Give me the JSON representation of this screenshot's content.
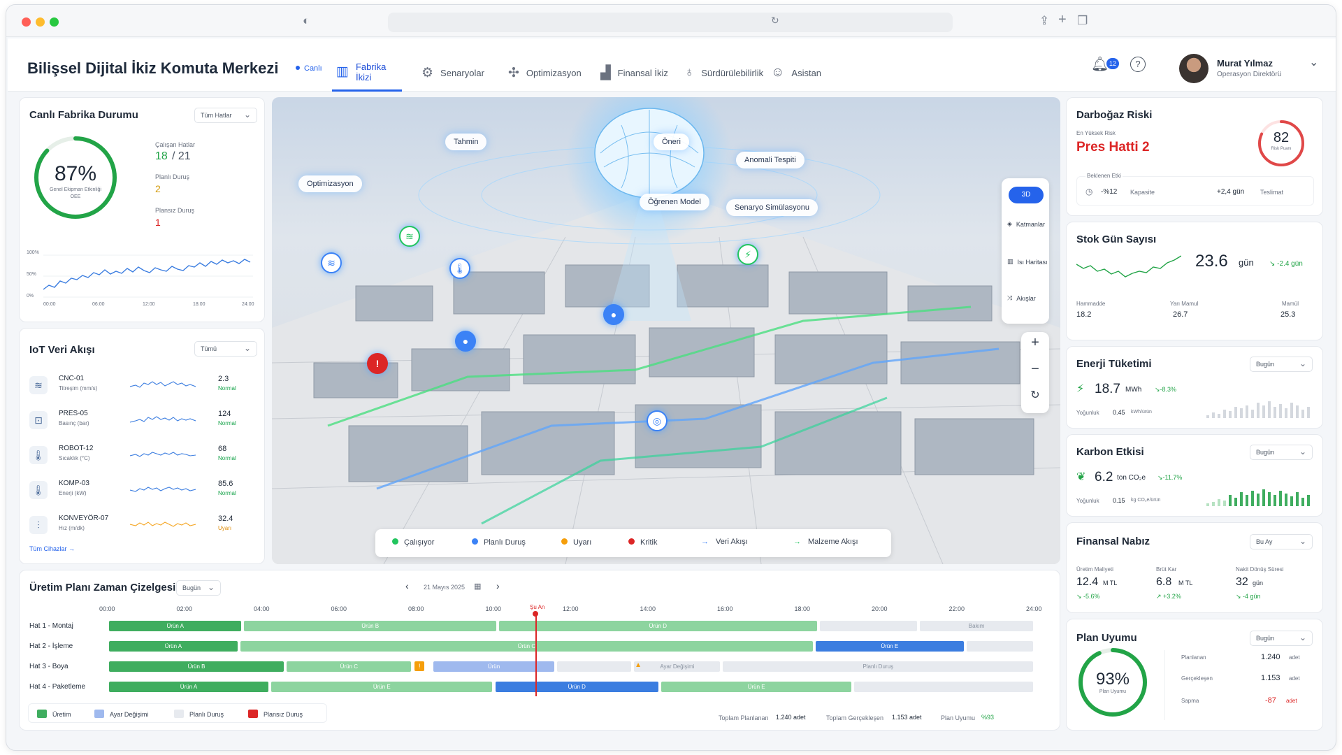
{
  "app": {
    "title": "Bilişsel Dijital İkiz Komuta Merkezi",
    "live_label": "Canlı",
    "nav": [
      {
        "label": "Fabrika İkizi",
        "icon": "factory-icon",
        "active": true
      },
      {
        "label": "Senaryolar",
        "icon": "scenario-icon",
        "active": false
      },
      {
        "label": "Optimizasyon",
        "icon": "optimization-icon",
        "active": false
      },
      {
        "label": "Finansal İkiz",
        "icon": "finance-icon",
        "active": false
      },
      {
        "label": "Sürdürülebilirlik",
        "icon": "sustainability-icon",
        "active": false
      },
      {
        "label": "Asistan",
        "icon": "assistant-icon",
        "active": false
      }
    ],
    "notifications": "12",
    "user": {
      "name": "Murat Yılmaz",
      "role": "Operasyon Direktörü"
    }
  },
  "factory": {
    "title": "Canlı Fabrika Durumu",
    "filter": "Tüm Hatlar",
    "oee_value": "87%",
    "oee_fraction": 0.87,
    "oee_label_1": "Genel Ekipman Etkinliği",
    "oee_label_2": "OEE",
    "running_label": "Çalışan Hatlar",
    "running_value": "18",
    "running_total": "/ 21",
    "planned_label": "Planlı Duruş",
    "planned_value": "2",
    "unplanned_label": "Plansız Duruş",
    "unplanned_value": "1",
    "chart_ylabels": [
      "100%",
      "50%",
      "0%"
    ],
    "chart_xlabels": [
      "00:00",
      "06:00",
      "12:00",
      "18:00",
      "24:00"
    ]
  },
  "iot": {
    "title": "IoT Veri Akışı",
    "filter": "Tümü",
    "rows": [
      {
        "name": "CNC-01",
        "sub": "Titreşim (mm/s)",
        "value": "2.3",
        "status": "Normal",
        "icon": "wifi-icon"
      },
      {
        "name": "PRES-05",
        "sub": "Basınç (bar)",
        "value": "124",
        "status": "Normal",
        "icon": "press-icon"
      },
      {
        "name": "ROBOT-12",
        "sub": "Sıcaklık (°C)",
        "value": "68",
        "status": "Normal",
        "icon": "thermometer-icon"
      },
      {
        "name": "KOMP-03",
        "sub": "Enerji (kW)",
        "value": "85.6",
        "status": "Normal",
        "icon": "energy-icon"
      },
      {
        "name": "KONVEYÖR-07",
        "sub": "Hız (m/dk)",
        "value": "32.4",
        "status": "Uyarı",
        "icon": "conveyor-icon"
      }
    ],
    "all_devices": "Tüm Cihazlar"
  },
  "twin": {
    "tags": [
      "Tahmin",
      "Öneri",
      "Anomali Tespiti",
      "Optimizasyon",
      "Öğrenen Model",
      "Senaryo Simülasyonu"
    ],
    "view_3d": "3D",
    "layers": "Katmanlar",
    "heatmap": "Isı Haritası",
    "flows": "Akışlar",
    "legend": [
      "Çalışıyor",
      "Planlı Duruş",
      "Uyarı",
      "Kritik",
      "Veri Akışı",
      "Malzeme Akışı"
    ]
  },
  "bottleneck": {
    "title": "Darboğaz Riski",
    "top_risk_label": "En Yüksek Risk",
    "top_risk": "Pres Hatti 2",
    "score": "82",
    "score_fraction": 0.82,
    "score_label": "Risk Puanı",
    "impact_label": "Beklenen Etki",
    "capacity_value": "-%12",
    "capacity_label": "Kapasite",
    "delivery_value": "+2,4 gün",
    "delivery_label": "Teslimat"
  },
  "stock": {
    "title": "Stok Gün Sayısı",
    "value": "23.6",
    "unit": "gün",
    "delta": "-2.4 gün",
    "items": [
      {
        "label": "Hammadde",
        "value": "18.2"
      },
      {
        "label": "Yarı Mamul",
        "value": "26.7"
      },
      {
        "label": "Mamül",
        "value": "25.3"
      }
    ]
  },
  "energy": {
    "title": "Enerji Tüketimi",
    "filter": "Bugün",
    "value": "18.7",
    "unit": "MWh",
    "delta": "-8.3%",
    "intensity_label": "Yoğunluk",
    "intensity_value": "0.45",
    "intensity_unit": "kWh/ürün"
  },
  "carbon": {
    "title": "Karbon Etkisi",
    "filter": "Bugün",
    "value": "6.2",
    "unit": "ton CO₂e",
    "delta": "-11.7%",
    "intensity_label": "Yoğunluk",
    "intensity_value": "0.15",
    "intensity_unit": "kg CO₂e/ürün"
  },
  "finance": {
    "title": "Finansal Nabız",
    "filter": "Bu Ay",
    "items": [
      {
        "label": "Üretim Maliyeti",
        "value": "12.4",
        "unit": "M TL",
        "delta": "-5.6%"
      },
      {
        "label": "Brüt Kar",
        "value": "6.8",
        "unit": "M TL",
        "delta": "+3.2%"
      },
      {
        "label": "Nakit Dönüş Süresi",
        "value": "32",
        "unit": "gün",
        "delta": "-4 gün"
      }
    ]
  },
  "plan": {
    "title": "Plan Uyumu",
    "filter": "Bugün",
    "value": "93%",
    "fraction": 0.93,
    "label": "Plan Uyumu",
    "rows": [
      {
        "label": "Planlanan",
        "value": "1.240",
        "unit": "adet"
      },
      {
        "label": "Gerçekleşen",
        "value": "1.153",
        "unit": "adet"
      },
      {
        "label": "Sapma",
        "value": "-87",
        "unit": "adet"
      }
    ]
  },
  "timeline": {
    "title": "Üretim Planı Zaman Çizelgesi",
    "filter": "Bugün",
    "date": "21 Mayıs 2025",
    "hours": [
      "00:00",
      "02:00",
      "04:00",
      "06:00",
      "08:00",
      "10:00",
      "12:00",
      "14:00",
      "16:00",
      "18:00",
      "20:00",
      "22:00",
      "24:00"
    ],
    "now_label": "Şu An",
    "rows": [
      {
        "label": "Hat 1 - Montaj",
        "segments": [
          {
            "start": 0,
            "end": 3.5,
            "text": "Ürün A",
            "kind": "g"
          },
          {
            "start": 3.5,
            "end": 10.1,
            "text": "Ürün B",
            "kind": "lg"
          },
          {
            "start": 10.1,
            "end": 18.4,
            "text": "Ürün D",
            "kind": "lg"
          },
          {
            "start": 18.4,
            "end": 21.0,
            "text": "",
            "kind": "gr"
          },
          {
            "start": 21.0,
            "end": 24,
            "text": "Bakım",
            "kind": "gr"
          }
        ]
      },
      {
        "label": "Hat 2 - İşleme",
        "segments": [
          {
            "start": 0,
            "end": 3.4,
            "text": "Ürün A",
            "kind": "g"
          },
          {
            "start": 3.4,
            "end": 18.3,
            "text": "Ürün C",
            "kind": "lg"
          },
          {
            "start": 18.3,
            "end": 22.2,
            "text": "Ürün E",
            "kind": "b"
          },
          {
            "start": 22.2,
            "end": 24,
            "text": "",
            "kind": "gr"
          }
        ]
      },
      {
        "label": "Hat 3 - Boya",
        "segments": [
          {
            "start": 0,
            "end": 4.6,
            "text": "Ürün B",
            "kind": "g"
          },
          {
            "start": 4.6,
            "end": 7.9,
            "text": "Ürün C",
            "kind": "lg"
          },
          {
            "start": 8.4,
            "end": 11.6,
            "text": "Ürün",
            "kind": "lb"
          },
          {
            "start": 11.6,
            "end": 13.6,
            "text": "",
            "kind": "gr"
          },
          {
            "start": 13.6,
            "end": 15.9,
            "text": "Ayar Değişimi",
            "kind": "gr"
          },
          {
            "start": 15.9,
            "end": 24,
            "text": "Planlı Duruş",
            "kind": "gr"
          }
        ]
      },
      {
        "label": "Hat 4 - Paketleme",
        "segments": [
          {
            "start": 0,
            "end": 4.2,
            "text": "Ürün A",
            "kind": "g"
          },
          {
            "start": 4.2,
            "end": 10.0,
            "text": "Ürün E",
            "kind": "lg"
          },
          {
            "start": 10.0,
            "end": 14.3,
            "text": "Ürün D",
            "kind": "b"
          },
          {
            "start": 14.3,
            "end": 19.3,
            "text": "Ürün E",
            "kind": "lg"
          },
          {
            "start": 19.3,
            "end": 24,
            "text": "",
            "kind": "gr"
          }
        ]
      }
    ],
    "legend": [
      "Üretim",
      "Ayar Değişimi",
      "Planlı Duruş",
      "Plansız Duruş"
    ],
    "total_planned_label": "Toplam Planlanan",
    "total_planned": "1.240 adet",
    "total_actual_label": "Toplam Gerçekleşen",
    "total_actual": "1.153 adet",
    "plan_ratio_label": "Plan Uyumu",
    "plan_ratio": "%93"
  },
  "colors": {
    "accent": "#2563eb",
    "ok": "#22a447",
    "warn": "#f59e0b",
    "critical": "#dc2626"
  }
}
